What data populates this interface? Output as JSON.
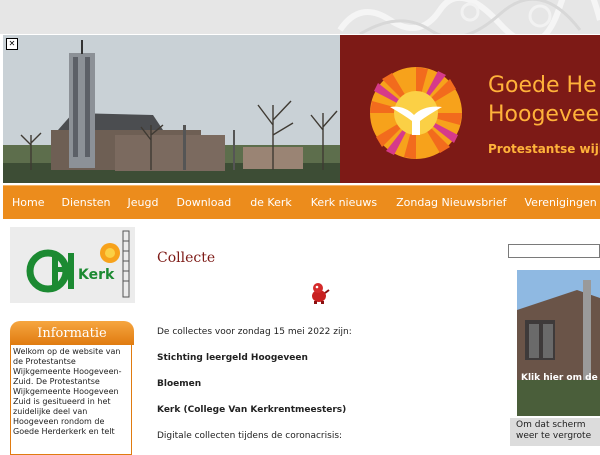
{
  "header": {
    "brand_title": "Goede He\nHoogevee",
    "brand_subtitle": "Protestantse wijkge"
  },
  "nav": {
    "items": [
      "Home",
      "Diensten",
      "Jeugd",
      "Download",
      "de Kerk",
      "Kerk nieuws",
      "Zondag Nieuwsbrief",
      "Verenigingen"
    ]
  },
  "sidebar": {
    "logo_text": "Kerk",
    "info_title": "Informatie",
    "info_text": "Welkom op de website van de Protestantse Wijkgemeente Hoogeveen-Zuid. De Protestantse Wijkgemeente Hoogeveen Zuid is gesitueerd in het zuidelijke deel van Hoogeveen rondom de Goede Herderkerk en telt"
  },
  "main": {
    "title": "Collecte",
    "intro": "De collectes voor zondag 15 mei 2022 zijn:",
    "item1": "Stichting leergeld Hoogeveen",
    "item2": "Bloemen",
    "item3": "Kerk (College Van Kerkrentmeesters)",
    "footer_line": "Digitale collecten tijdens de coronacrisis:"
  },
  "right": {
    "photo_overlay": "Klik hier om de",
    "caption": "Om dat scherm\nweer te vergrote"
  },
  "colors": {
    "brand_red": "#7d1a16",
    "brand_orange": "#ec8c1c",
    "brand_gold": "#ffb23a"
  }
}
